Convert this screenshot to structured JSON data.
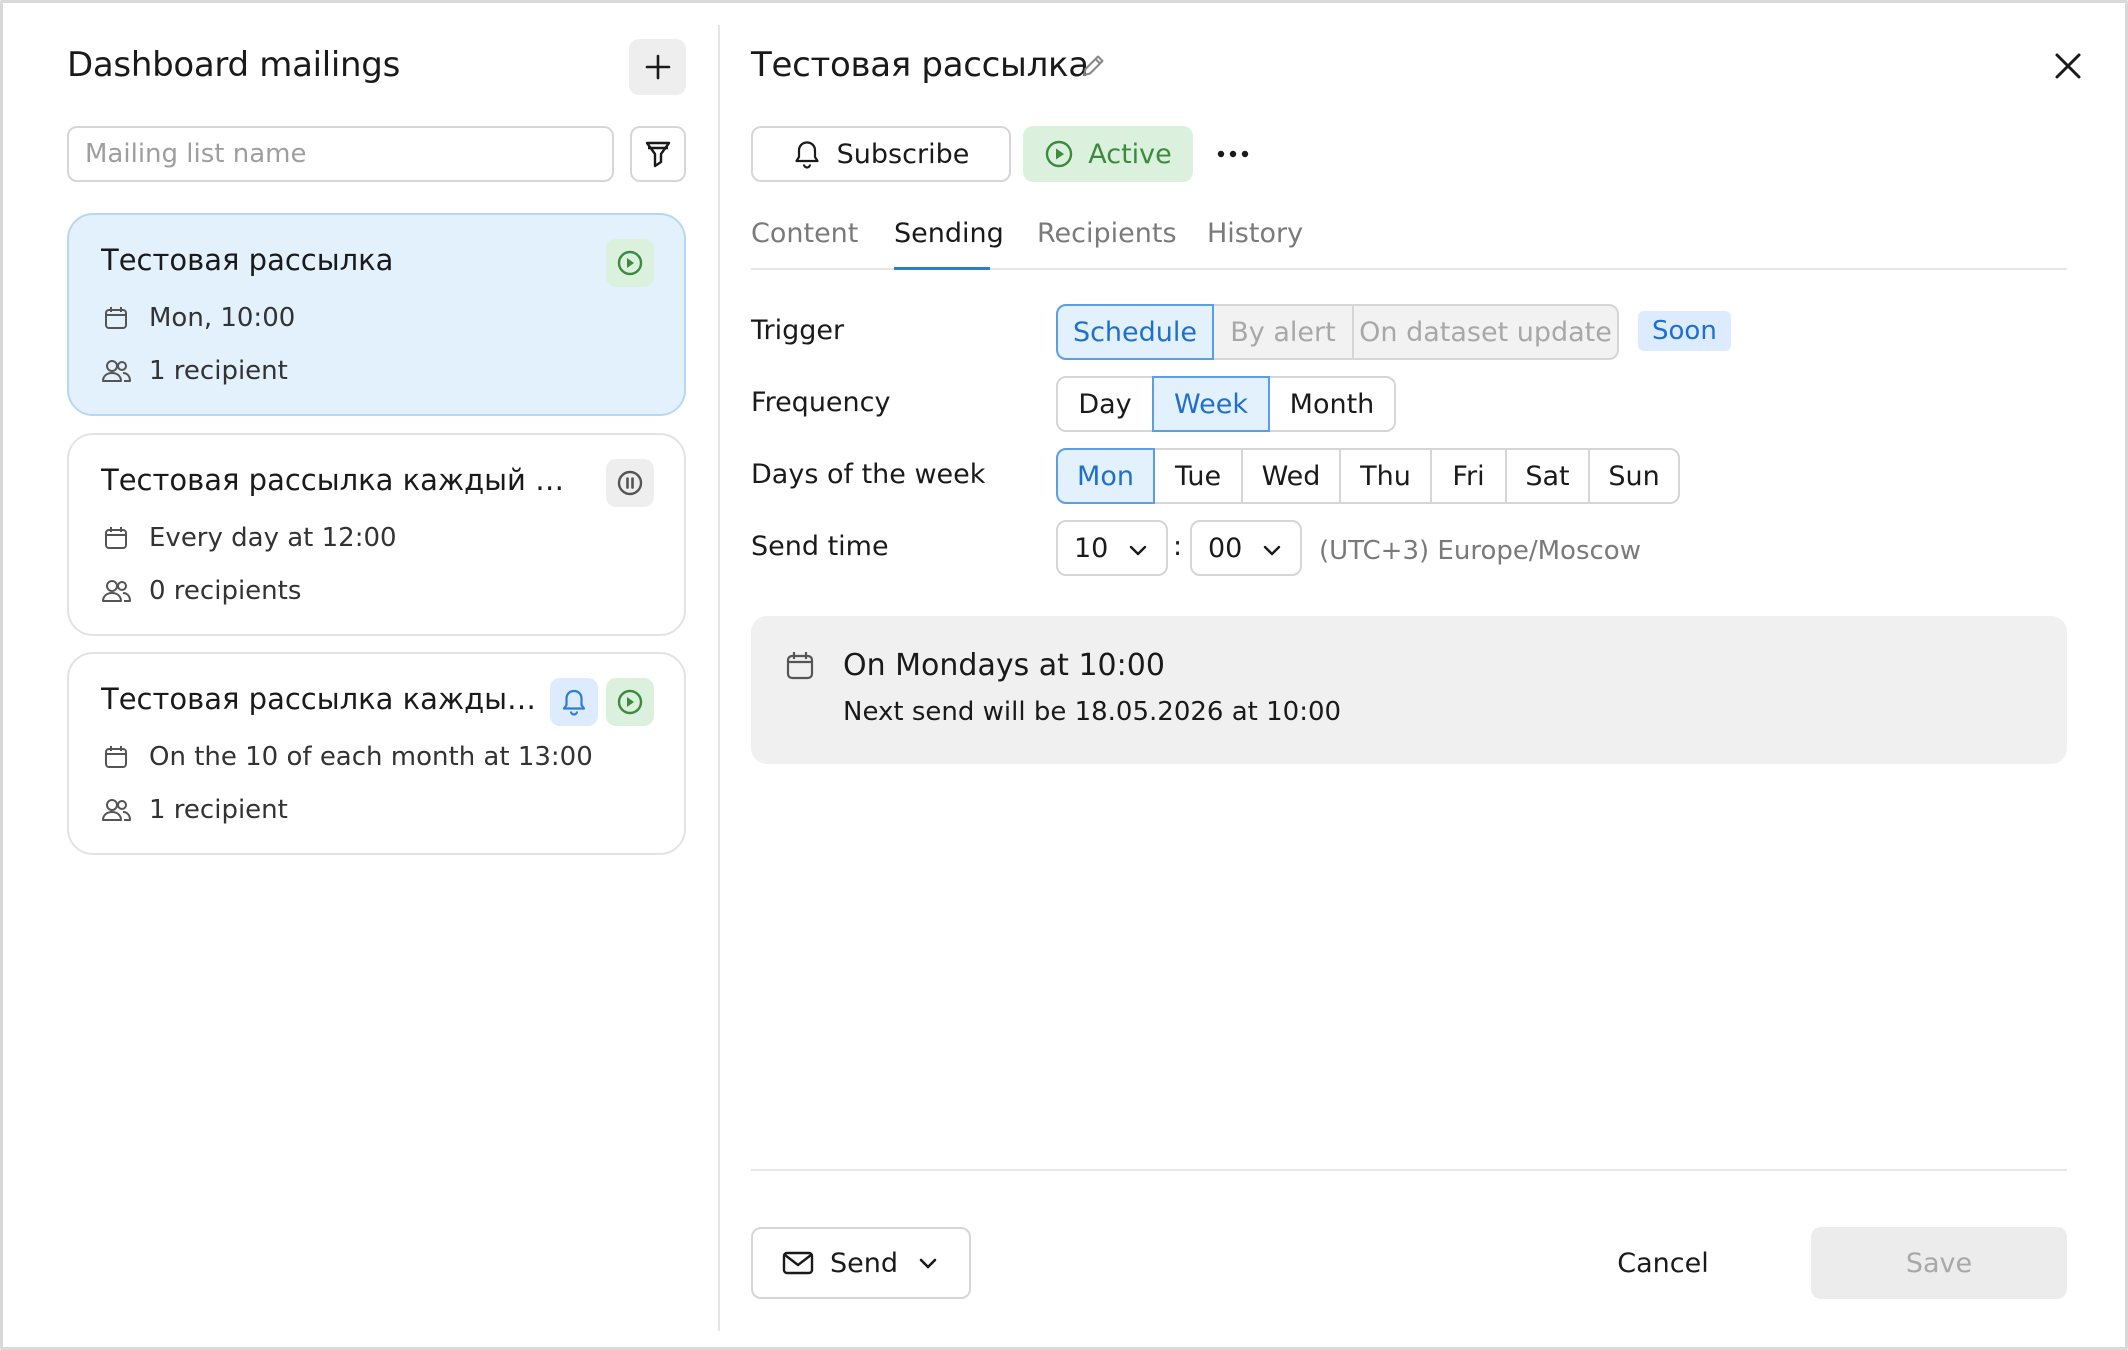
{
  "left": {
    "title": "Dashboard mailings",
    "search_placeholder": "Mailing list name",
    "cards": [
      {
        "title": "Тестовая рассылка",
        "schedule": "Mon, 10:00",
        "recipients": "1 recipient",
        "status": "active"
      },
      {
        "title": "Тестовая рассылка каждый день",
        "schedule": "Every day at 12:00",
        "recipients": "0 recipients",
        "status": "paused"
      },
      {
        "title": "Тестовая рассылка каждый м...",
        "schedule": "On the 10 of each month at 13:00",
        "recipients": "1 recipient",
        "status": "active",
        "subscribed": true
      }
    ]
  },
  "right": {
    "title": "Тестовая рассылка",
    "subscribe_label": "Subscribe",
    "status_label": "Active",
    "tabs": [
      "Content",
      "Sending",
      "Recipients",
      "History"
    ],
    "active_tab": "Sending",
    "trigger": {
      "label": "Trigger",
      "options": [
        "Schedule",
        "By alert",
        "On dataset update"
      ],
      "selected": "Schedule",
      "soon_label": "Soon"
    },
    "frequency": {
      "label": "Frequency",
      "options": [
        "Day",
        "Week",
        "Month"
      ],
      "selected": "Week"
    },
    "days": {
      "label": "Days of the week",
      "options": [
        "Mon",
        "Tue",
        "Wed",
        "Thu",
        "Fri",
        "Sat",
        "Sun"
      ],
      "selected": "Mon"
    },
    "send_time": {
      "label": "Send time",
      "hour": "10",
      "minute": "00",
      "separator": ":",
      "timezone": "(UTC+3) Europe/Moscow"
    },
    "summary": {
      "title": "On Mondays at 10:00",
      "next": "Next send will be 18.05.2026 at 10:00"
    },
    "footer": {
      "send_label": "Send",
      "cancel_label": "Cancel",
      "save_label": "Save"
    }
  },
  "colors": {
    "accent": "#2f7bd6",
    "selected_bg": "#e3f1fd",
    "active_green": "#3b8a3e",
    "active_green_bg": "#dcf1dd"
  }
}
